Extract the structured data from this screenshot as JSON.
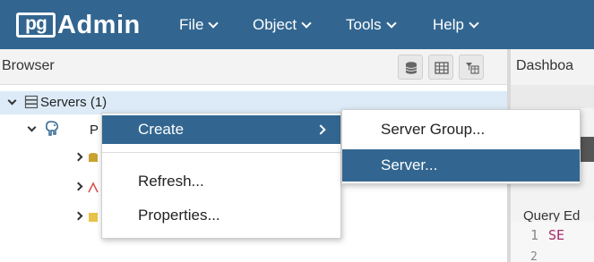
{
  "app": {
    "logo_pg": "pg",
    "logo_admin": "Admin",
    "accent_color": "#326690"
  },
  "menu": {
    "file": "File",
    "object": "Object",
    "tools": "Tools",
    "help": "Help"
  },
  "browser": {
    "title": "Browser",
    "toolbar_icons": [
      "database-icon",
      "table-icon",
      "sql-filter-icon"
    ]
  },
  "tree": {
    "servers_label": "Servers (1)",
    "child_partial": "P"
  },
  "right_panel": {
    "dashboard_tab": "Dashboa",
    "query_label": "Query Ed",
    "line_1": "1",
    "line_1_code": "SE",
    "line_2": "2"
  },
  "context_menu": {
    "items": [
      "Create",
      "Refresh...",
      "Properties..."
    ]
  },
  "submenu": {
    "items": [
      "Server Group...",
      "Server..."
    ]
  }
}
